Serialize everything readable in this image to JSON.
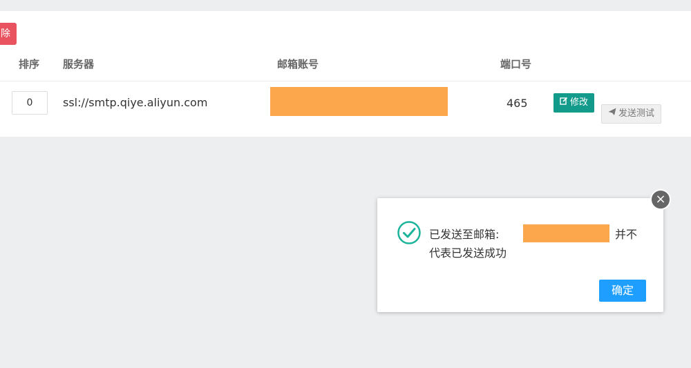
{
  "toolbar": {
    "delete_label": "除"
  },
  "table": {
    "headers": [
      "排序",
      "服务器",
      "邮箱账号",
      "端口号"
    ],
    "rows": [
      {
        "sort": "0",
        "server": "ssl://smtp.qiye.aliyun.com",
        "port": "465"
      }
    ],
    "edit_label": "修改",
    "test_label": "发送测试"
  },
  "dialog": {
    "message_prefix": "已发送至邮箱:",
    "message_suffix": "并不",
    "message_line2": "代表已发送成功",
    "confirm_label": "确定",
    "close_symbol": "×"
  },
  "colors": {
    "danger": "#e8535f",
    "primary_teal": "#129a8a",
    "confirm_blue": "#1e9fff",
    "redaction": "#fda74d",
    "success": "#1cb39b"
  },
  "icons": [
    "edit-icon",
    "send-icon",
    "success-check-icon",
    "close-icon"
  ]
}
